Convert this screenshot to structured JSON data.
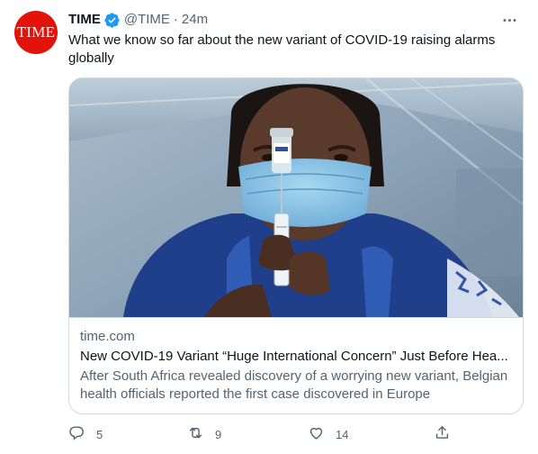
{
  "tweet": {
    "avatar": {
      "label": "TIME",
      "color": "#e3120b"
    },
    "author": {
      "name": "TIME",
      "handle": "@TIME",
      "separator": "·",
      "time": "24m",
      "verified": true
    },
    "text": "What we know so far about the new variant of COVID-19 raising alarms globally",
    "card": {
      "domain": "time.com",
      "title": "New COVID-19 Variant “Huge International Concern” Just Before Hea...",
      "description": "After South Africa revealed discovery of a worrying new variant, Belgian health officials reported the first case discovered in Europe"
    },
    "actions": {
      "replies": "5",
      "retweets": "9",
      "likes": "14"
    },
    "icons": {
      "verified": "verified-badge-icon",
      "more": "more-options-icon",
      "reply": "reply-icon",
      "retweet": "retweet-icon",
      "like": "heart-icon",
      "share": "share-icon"
    },
    "colors": {
      "accent": "#1d9bf0",
      "text": "#0f1419",
      "muted": "#536471",
      "border": "#cfd9de"
    }
  }
}
